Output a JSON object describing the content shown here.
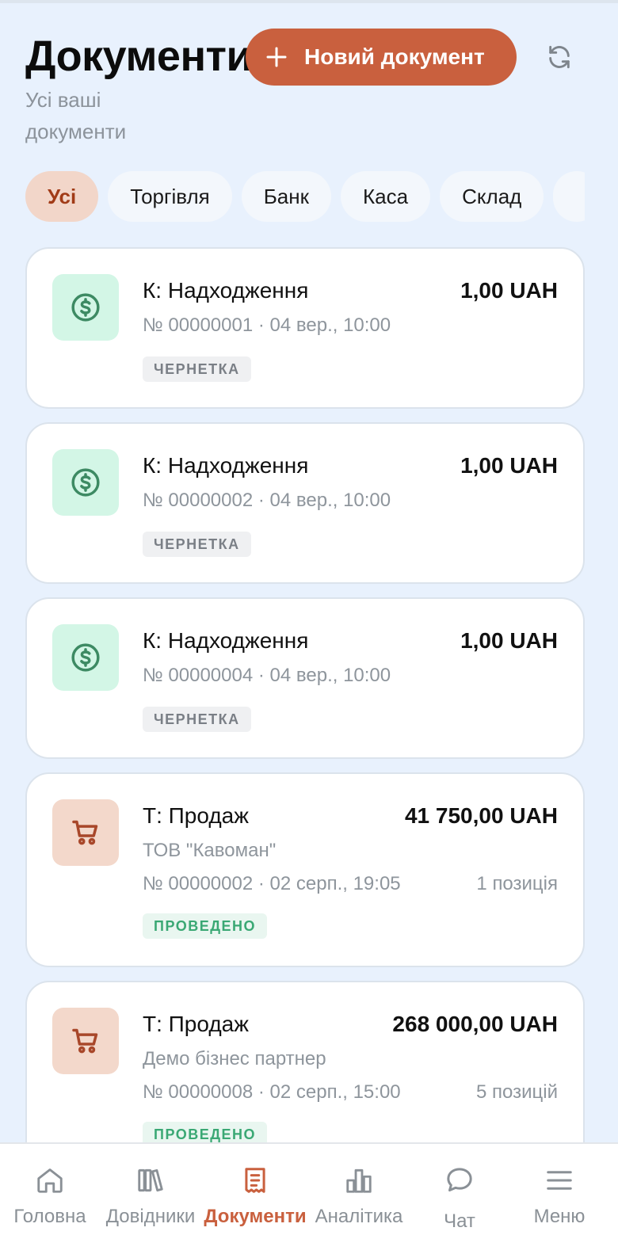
{
  "header": {
    "title": "Документи",
    "subtitle": "Усі ваші документи",
    "new_button_label": "Новий документ"
  },
  "filters": [
    {
      "label": "Усі",
      "active": true
    },
    {
      "label": "Торгівля",
      "active": false
    },
    {
      "label": "Банк",
      "active": false
    },
    {
      "label": "Каса",
      "active": false
    },
    {
      "label": "Склад",
      "active": false
    },
    {
      "label": "",
      "active": false
    }
  ],
  "documents": [
    {
      "title": "К: Надходження",
      "amount": "1,00 UAH",
      "meta": "№ 00000001 · 04 вер., 10:00",
      "status": "ЧЕРНЕТКА",
      "icon": "dollar-icon"
    },
    {
      "title": "К: Надходження",
      "amount": "1,00 UAH",
      "meta": "№ 00000002 · 04 вер., 10:00",
      "status": "ЧЕРНЕТКА",
      "icon": "dollar-icon"
    },
    {
      "title": "К: Надходження",
      "amount": "1,00 UAH",
      "meta": "№ 00000004 · 04 вер., 10:00",
      "status": "ЧЕРНЕТКА",
      "icon": "dollar-icon"
    },
    {
      "title": "Т: Продаж",
      "amount": "41 750,00 UAH",
      "partner": "ТОВ \"Кавоман\"",
      "meta": "№ 00000002 · 02 серп., 19:05",
      "positions": "1 позиція",
      "status": "ПРОВЕДЕНО",
      "icon": "cart-icon"
    },
    {
      "title": "Т: Продаж",
      "amount": "268 000,00 UAH",
      "partner": "Демо бізнес партнер",
      "meta": "№ 00000008 · 02 серп., 15:00",
      "positions": "5 позицій",
      "status": "ПРОВЕДЕНО",
      "icon": "cart-icon"
    }
  ],
  "nav": [
    {
      "label": "Головна",
      "icon": "home-icon",
      "active": false
    },
    {
      "label": "Довідники",
      "icon": "books-icon",
      "active": false
    },
    {
      "label": "Документи",
      "icon": "receipt-icon",
      "active": true
    },
    {
      "label": "Аналітика",
      "icon": "bar-chart-icon",
      "active": false
    },
    {
      "label": "Чат",
      "icon": "chat-icon",
      "active": false
    },
    {
      "label": "Меню",
      "icon": "menu-icon",
      "active": false
    }
  ],
  "colors": {
    "accent": "#c9603e",
    "background": "#e8f1fd",
    "posted": "#3aa874",
    "money_icon": "#3d8a63",
    "cart_icon": "#a8472a"
  }
}
